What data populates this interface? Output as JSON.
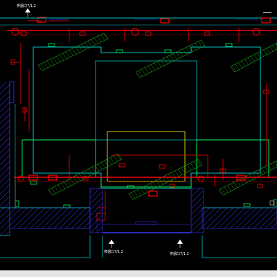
{
  "drawing": {
    "labels": {
      "top_left_label": "排烟口7/1.2",
      "bottom_left_label": "排烟口7/1.2",
      "bottom_right_label": "排烟口7/1.2"
    },
    "colors": {
      "background": "#000000",
      "wall_cyan": "#00c8c8",
      "wall_green": "#00ff66",
      "duct_red": "#ff0000",
      "hatch_blue": "#3a3aff",
      "outline_yellow": "#e6e600",
      "annotation_white": "#ffffff",
      "diffuser_green": "#18a818"
    }
  }
}
